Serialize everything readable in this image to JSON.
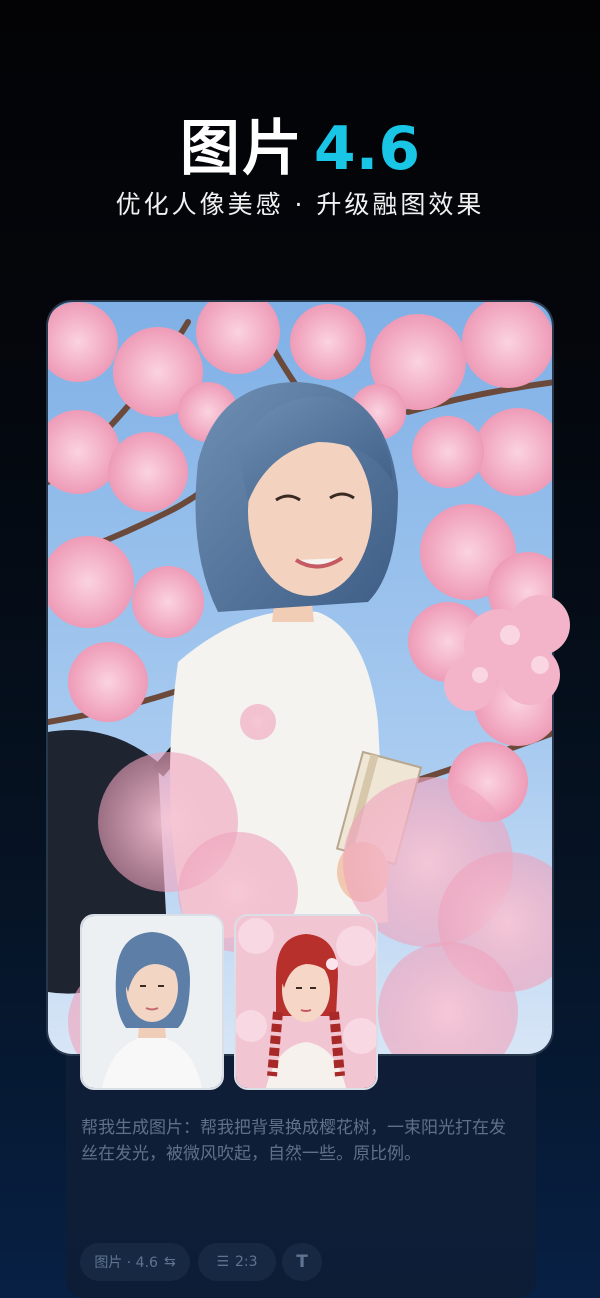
{
  "header": {
    "title_cn": "图片",
    "title_version": "4.6",
    "subtitle": "优化人像美感 · 升级融图效果"
  },
  "composer": {
    "prompt": "帮我生成图片：帮我把背景换成樱花树，一束阳光打在发丝在发光，被微风吹起，自然一些。原比例。",
    "model_chip_label": "图片 · 4.6",
    "ratio_chip_label": "2:3",
    "icons": {
      "model": "swap-arrows-icon",
      "ratio": "sliders-icon",
      "text": "text-size-icon"
    }
  },
  "images": {
    "main": "blue-haired girl among cherry blossoms",
    "reference_1": "blue-haired girl portrait",
    "reference_2": "red-haired girl with braids among blossoms"
  },
  "colors": {
    "accent": "#19c6e6",
    "background_top": "#030305",
    "background_bottom": "#072044",
    "prompt_text": "#5e7188"
  }
}
